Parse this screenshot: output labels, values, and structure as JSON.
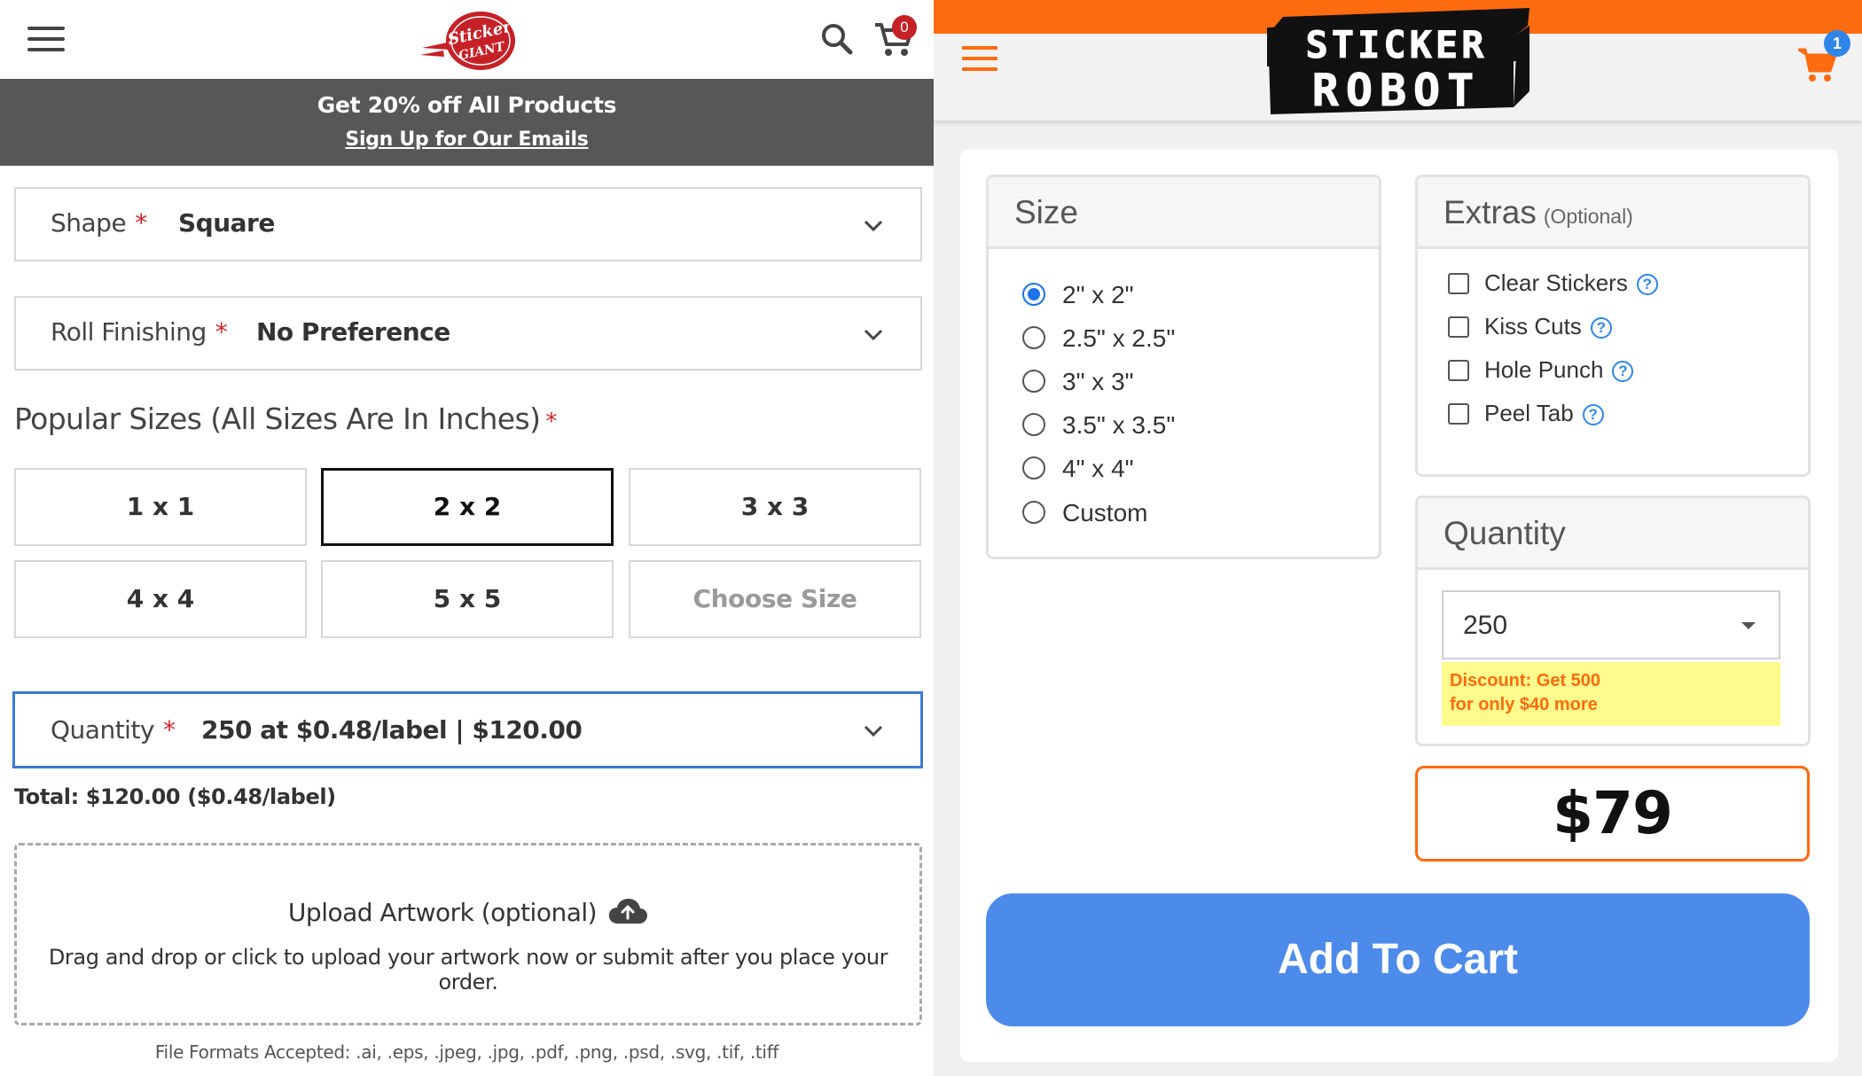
{
  "sticker_giant": {
    "cart_count": "0",
    "logo_text": "Sticker Giant",
    "banner": {
      "headline": "Get 20% off All Products",
      "link": "Sign Up for Our Emails"
    },
    "shape": {
      "label": "Shape",
      "required": "*",
      "value": "Square"
    },
    "roll_finishing": {
      "label": "Roll Finishing",
      "required": "*",
      "value": "No Preference"
    },
    "popular_sizes": {
      "title": "Popular Sizes (All Sizes Are In Inches)",
      "required": "*",
      "options": [
        "1 x 1",
        "2 x 2",
        "3 x 3",
        "4 x 4",
        "5 x 5",
        "Choose Size"
      ],
      "selected": "2 x 2"
    },
    "quantity": {
      "label": "Quantity",
      "required": "*",
      "value": "250 at $0.48/label | $120.00"
    },
    "total": "Total: $120.00 ($0.48/label)",
    "upload": {
      "title": "Upload Artwork (optional)",
      "description": "Drag and drop or click to upload your artwork now or submit after you place your order."
    },
    "file_formats": "File Formats Accepted: .ai, .eps, .jpeg, .jpg, .pdf, .png, .psd, .svg, .tif, .tiff",
    "colors": {
      "banner": "#555759",
      "accent_red": "#c62127",
      "focus_blue": "#3a7bd5"
    }
  },
  "sticker_robot": {
    "logo_lines": [
      "STICKER",
      "ROBOT"
    ],
    "cart_count": "1",
    "size_panel": {
      "title": "Size",
      "options": [
        "2\" x 2\"",
        "2.5\" x 2.5\"",
        "3\" x 3\"",
        "3.5\" x 3.5\"",
        "4\" x 4\"",
        "Custom"
      ],
      "selected": "2\" x 2\""
    },
    "extras_panel": {
      "title": "Extras",
      "subtitle": "(Optional)",
      "options": [
        "Clear Stickers",
        "Kiss Cuts",
        "Hole Punch",
        "Peel Tab"
      ],
      "help_glyph": "?"
    },
    "quantity_panel": {
      "title": "Quantity",
      "value": "250",
      "discount_line1": "Discount: Get 500",
      "discount_line2": "for only $40 more"
    },
    "price": "$79",
    "add_to_cart": "Add To Cart",
    "colors": {
      "brand_orange": "#ff6b0f",
      "button_blue": "#4d8beb",
      "badge_blue": "#2f86e8",
      "discount_bg": "#fffa8c"
    }
  }
}
